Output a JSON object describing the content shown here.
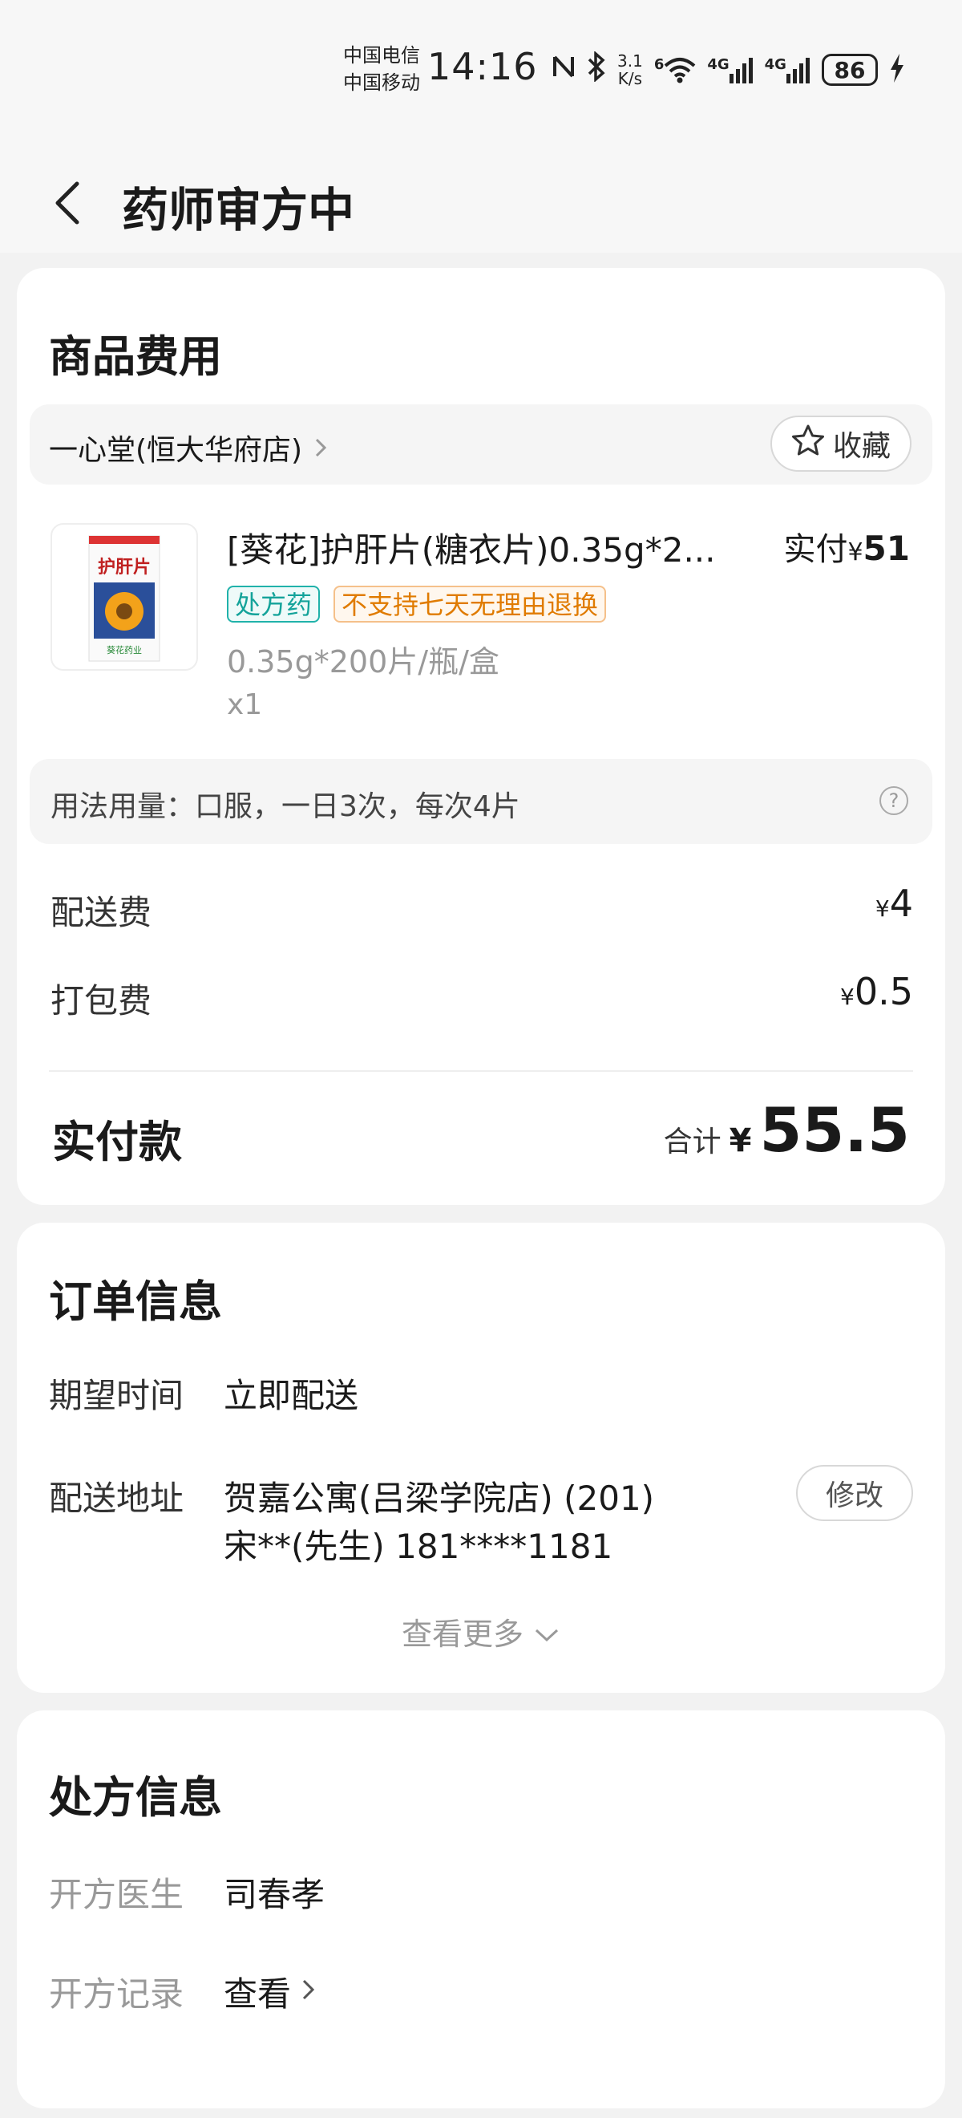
{
  "status_bar": {
    "carrier_1": "中国电信",
    "carrier_2": "中国移动",
    "time": "14:16",
    "net_speed_value": "3.1",
    "net_speed_unit": "K/s",
    "wifi_badge": "6",
    "network_1": "4G",
    "network_2": "4G",
    "battery": "86"
  },
  "nav": {
    "title": "药师审方中"
  },
  "goods": {
    "section_title": "商品费用",
    "store_name": "一心堂(恒大华府店)",
    "favorite_label": "收藏",
    "product": {
      "name": "[葵花]护肝片(糖衣片)0.35g*2...",
      "pay_prefix": "实付",
      "pay_currency": "¥",
      "pay_amount": "51",
      "tag_rx": "处方药",
      "tag_no_return": "不支持七天无理由退换",
      "spec": "0.35g*200片/瓶/盒",
      "quantity": "x1",
      "image_box_text": "护肝片",
      "image_brand": "葵花药业"
    },
    "usage": "用法用量：口服，一日3次，每次4片",
    "delivery_fee_label": "配送费",
    "delivery_fee_currency": "¥",
    "delivery_fee_value": "4",
    "packing_fee_label": "打包费",
    "packing_fee_currency": "¥",
    "packing_fee_value": "0.5",
    "total_label": "实付款",
    "total_caption": "合计",
    "total_currency": "¥",
    "total_amount": "55.5"
  },
  "order": {
    "section_title": "订单信息",
    "expected_time_label": "期望时间",
    "expected_time_value": "立即配送",
    "address_label": "配送地址",
    "address_line_1": "贺嘉公寓(吕梁学院店) (201)",
    "address_line_2": "宋**(先生) 181****1181",
    "modify_label": "修改",
    "see_more_label": "查看更多"
  },
  "prescription": {
    "section_title": "处方信息",
    "doctor_label": "开方医生",
    "doctor_value": "司春孝",
    "record_label": "开方记录",
    "record_link": "查看"
  },
  "colors": {
    "rx_tag": "#14a39a",
    "no_return_tag": "#e07b00",
    "background": "#f2f2f2"
  }
}
